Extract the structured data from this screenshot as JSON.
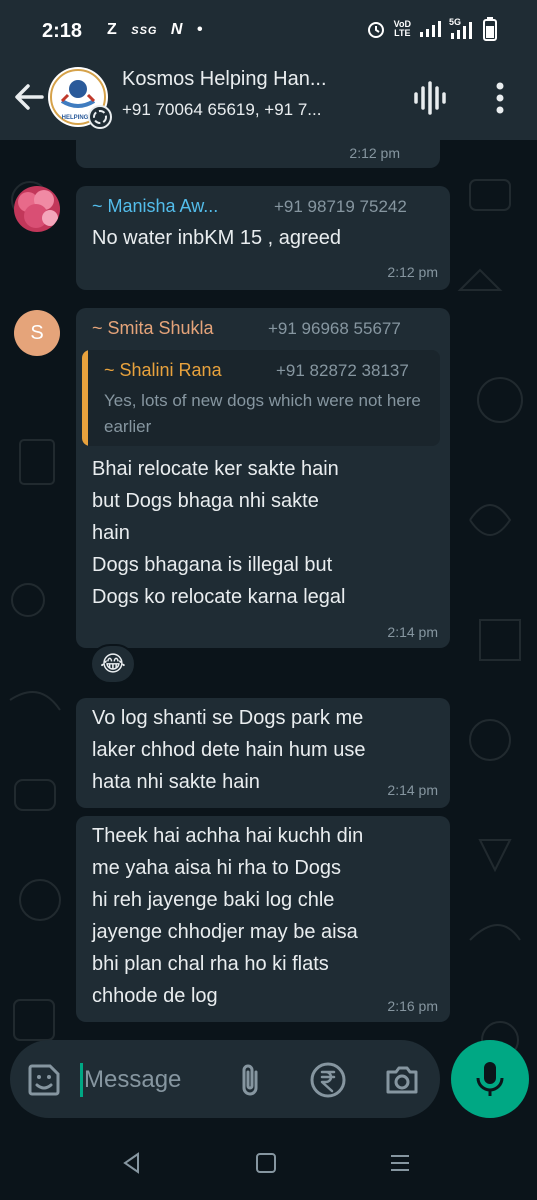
{
  "status_bar": {
    "time": "2:18",
    "left_icons": [
      "Z",
      "SSG",
      "N",
      "•"
    ],
    "right_icons": [
      "alarm-icon",
      "volte-icon",
      "signal-icon",
      "5g-signal-icon",
      "battery-icon"
    ],
    "volte_label_1": "VoD",
    "volte_label_2": "LTE",
    "network_label": "5G"
  },
  "header": {
    "title": "Kosmos Helping Han...",
    "subtitle": "+91 70064 65619, +91 7...",
    "avatar_text": "HELPING H"
  },
  "messages": [
    {
      "id": "m0",
      "time": "2:12 pm"
    },
    {
      "id": "m1",
      "sender": "~ Manisha  Aw...",
      "sender_color": "#53bdeb",
      "phone": "+91 98719 75242",
      "text": "No water inbKM 15 , agreed",
      "time": "2:12 pm"
    },
    {
      "id": "m2",
      "sender": "~ Smita Shukla",
      "sender_color": "#e5a47a",
      "phone": "+91 96968 55677",
      "avatar_letter": "S",
      "quote": {
        "sender": "~ Shalini Rana",
        "phone": "+91 82872 38137",
        "text": "Yes, lots of new dogs which were not here earlier"
      },
      "text": "Bhai relocate ker sakte hain\nbut Dogs  bhaga  nhi sakte\nhain\nDogs bhagana is illegal but\nDogs ko relocate karna legal",
      "time": "2:14 pm",
      "reaction": "😂"
    },
    {
      "id": "m3",
      "text": "Vo log shanti se Dogs park me\nlaker chhod dete hain hum use\nhata nhi sakte hain",
      "time": "2:14 pm"
    },
    {
      "id": "m4",
      "text": "Theek hai achha hai kuchh din\nme  yaha aisa hi rha to Dogs\nhi reh jayenge  baki log  chle\njayenge  chhodjer may be aisa\nbhi plan chal rha ho ki flats\nchhode de log",
      "time": "2:16 pm"
    }
  ],
  "composer": {
    "placeholder": "Message"
  },
  "colors": {
    "background": "#0b141a",
    "bar": "#1f2c34",
    "bubble": "#1f2c34",
    "accent": "#00a884"
  }
}
